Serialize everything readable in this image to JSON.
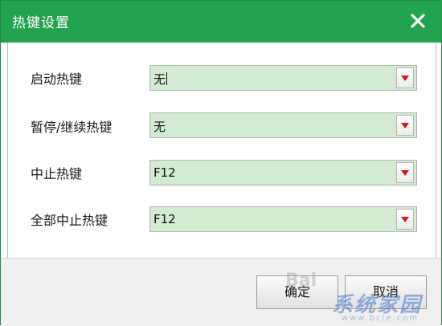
{
  "dialog": {
    "title": "热键设置",
    "close_icon": "close-icon"
  },
  "rows": [
    {
      "label": "启动热键",
      "value": "无"
    },
    {
      "label": "暂停/继续热键",
      "value": "无"
    },
    {
      "label": "中止热键",
      "value": "F12"
    },
    {
      "label": "全部中止热键",
      "value": "F12"
    }
  ],
  "footer": {
    "ok_label": "确定",
    "cancel_label": "取消"
  },
  "watermark": {
    "baidu": "Bai",
    "brand": "系统家园",
    "url": "www.bcle.com"
  },
  "colors": {
    "titlebar": "#23a34f",
    "combo_bg": "#d2ebd2",
    "arrow": "#cc1a1a"
  }
}
